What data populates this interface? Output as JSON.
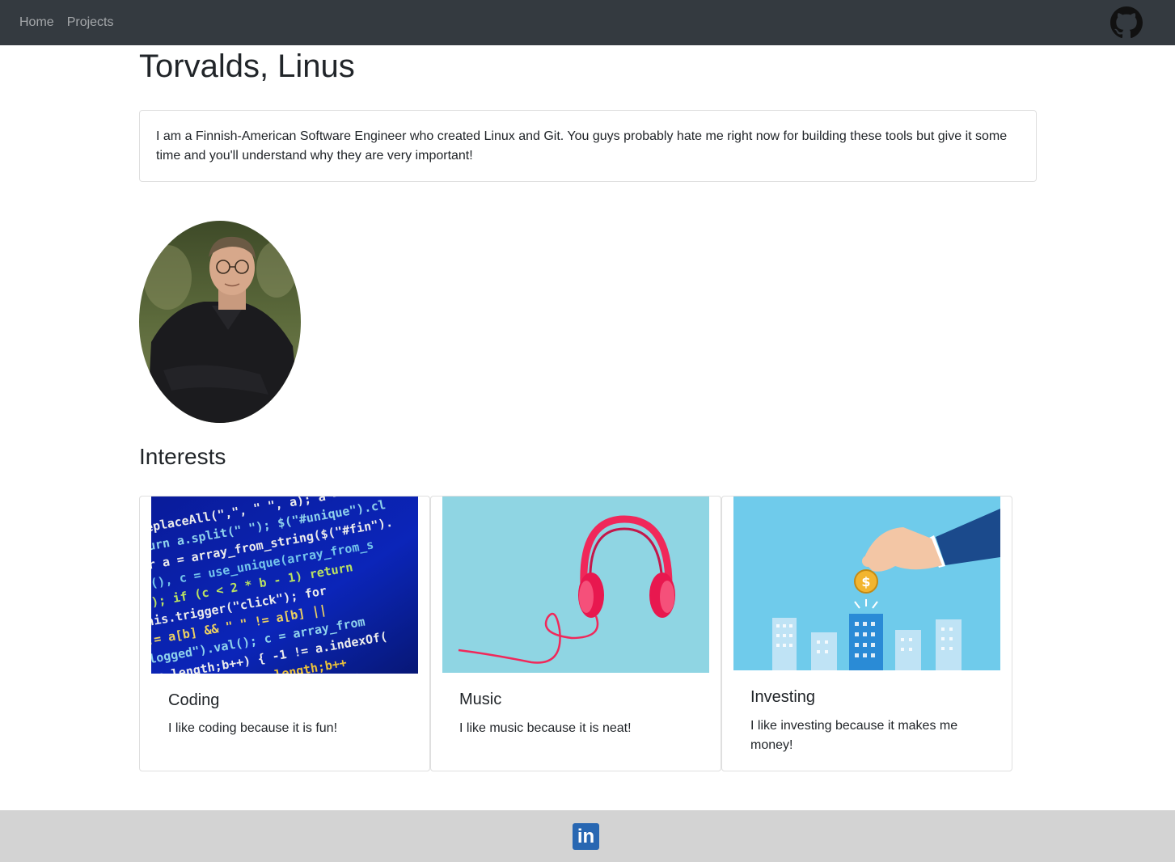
{
  "nav": {
    "items": [
      {
        "label": "Home"
      },
      {
        "label": "Projects"
      }
    ]
  },
  "header": {
    "title": "Torvalds, Linus"
  },
  "bio": {
    "text": "I am a Finnish-American Software Engineer who created Linux and Git. You guys probably hate me right now for building these tools but give it some time and you'll understand why they are very important!"
  },
  "interests": {
    "heading": "Interests",
    "cards": [
      {
        "title": "Coding",
        "text": "I like coding because it is fun!"
      },
      {
        "title": "Music",
        "text": "I like music because it is neat!"
      },
      {
        "title": "Investing",
        "text": "I like investing because it makes me money!"
      }
    ]
  },
  "colors": {
    "navbar": "#343a40",
    "footer": "#d3d3d3",
    "linkedin": "#2867b2"
  },
  "icons": {
    "github": "github-icon",
    "linkedin": "linkedin-icon"
  },
  "footer": {
    "linkedin_glyph": "in"
  }
}
